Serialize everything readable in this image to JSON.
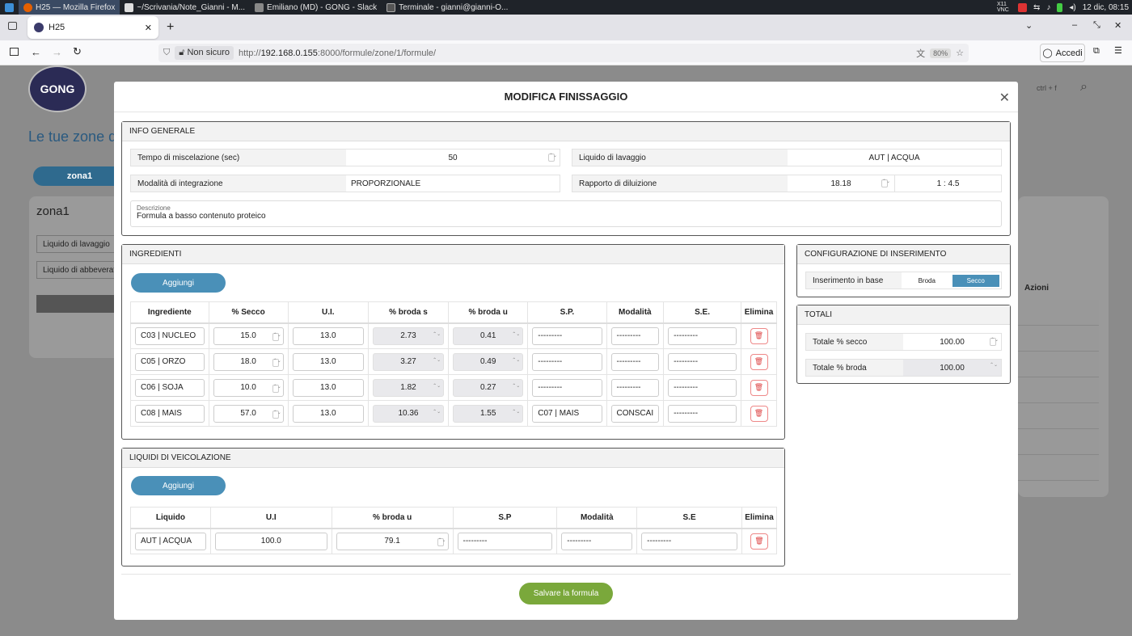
{
  "taskbar": {
    "items": [
      "H25 — Mozilla Firefox",
      "~/Scrivania/Note_Gianni - M...",
      "Emiliano (MD) - GONG - Slack",
      "Terminale - gianni@gianni-O..."
    ],
    "datetime": "12 dic, 08:15",
    "vnc": "X11 VNC"
  },
  "browser": {
    "tab_title": "H25",
    "not_secure": "Non sicuro",
    "url_prefix": "http://",
    "url_host": "192.168.0.155",
    "url_path": ":8000/formule/zone/1/formule/",
    "zoom": "80%",
    "login": "Accedi"
  },
  "background": {
    "page_title": "Le tue zone d",
    "zone_tab": "zona1",
    "zone_name": "zona1",
    "field1": "Liquido di lavaggio",
    "field2": "Liquido di abbeverata",
    "search_hint": "ctrl + f",
    "actions_header": "Azioni"
  },
  "modal": {
    "title": "MODIFICA FINISSAGGIO",
    "info": {
      "header": "INFO GENERALE",
      "mix_label": "Tempo di miscelazione (sec)",
      "mix_value": "50",
      "wash_label": "Liquido di lavaggio",
      "wash_value": "AUT | ACQUA",
      "integration_label": "Modalità di integrazione",
      "integration_value": "PROPORZIONALE",
      "dilution_label": "Rapporto di diluizione",
      "dilution_value": "18.18",
      "dilution_ratio": "1 : 4.5",
      "desc_label": "Descrizione",
      "desc_value": "Formula a basso contenuto proteico"
    },
    "ingredients": {
      "header": "INGREDIENTI",
      "add": "Aggiungi",
      "columns": [
        "Ingrediente",
        "% Secco",
        "U.I.",
        "% broda s",
        "% broda u",
        "S.P.",
        "Modalità",
        "S.E.",
        "Elimina"
      ],
      "rows": [
        {
          "name": "C03 | NUCLEO",
          "secco": "15.0",
          "ui": "13.0",
          "bs": "2.73",
          "bu": "0.41",
          "sp": "---------",
          "mod": "---------",
          "se": "---------"
        },
        {
          "name": "C05 | ORZO",
          "secco": "18.0",
          "ui": "13.0",
          "bs": "3.27",
          "bu": "0.49",
          "sp": "---------",
          "mod": "---------",
          "se": "---------"
        },
        {
          "name": "C06 | SOJA",
          "secco": "10.0",
          "ui": "13.0",
          "bs": "1.82",
          "bu": "0.27",
          "sp": "---------",
          "mod": "---------",
          "se": "---------"
        },
        {
          "name": "C08 | MAIS",
          "secco": "57.0",
          "ui": "13.0",
          "bs": "10.36",
          "bu": "1.55",
          "sp": "C07 | MAIS",
          "mod": "CONSCAI",
          "se": "---------"
        }
      ]
    },
    "config": {
      "header": "CONFIGURAZIONE DI INSERIMENTO",
      "label": "Inserimento in base",
      "opt1": "Broda",
      "opt2": "Secco"
    },
    "totals": {
      "header": "TOTALI",
      "secco_label": "Totale % secco",
      "secco_value": "100.00",
      "broda_label": "Totale % broda",
      "broda_value": "100.00"
    },
    "liquids": {
      "header": "LIQUIDI DI VEICOLAZIONE",
      "add": "Aggiungi",
      "columns": [
        "Liquido",
        "U.I",
        "% broda u",
        "S.P",
        "Modalità",
        "S.E",
        "Elimina"
      ],
      "rows": [
        {
          "name": "AUT | ACQUA",
          "ui": "100.0",
          "bu": "79.1",
          "sp": "---------",
          "mod": "---------",
          "se": "---------"
        }
      ]
    },
    "save": "Salvare la formula"
  }
}
